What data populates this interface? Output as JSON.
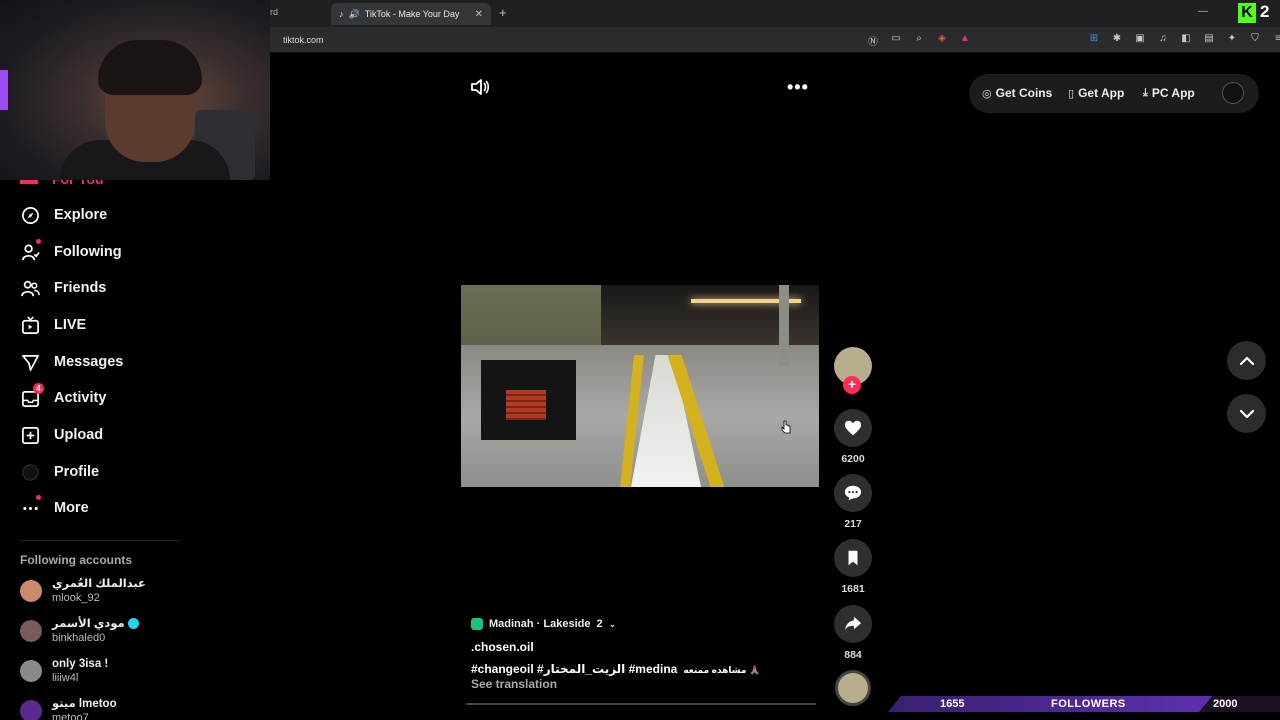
{
  "browser": {
    "partial_tab_label": "rd",
    "active_tab_title": "TikTok - Make Your Day",
    "url": "tiktok.com",
    "kick_count": "2"
  },
  "sidebar": {
    "for_you_label": "For You",
    "items": [
      {
        "label": "Explore",
        "icon": "compass-icon"
      },
      {
        "label": "Following",
        "icon": "user-follow-icon"
      },
      {
        "label": "Friends",
        "icon": "friends-icon"
      },
      {
        "label": "LIVE",
        "icon": "live-tv-icon"
      },
      {
        "label": "Messages",
        "icon": "paper-plane-icon"
      },
      {
        "label": "Activity",
        "icon": "inbox-icon",
        "badge": "4"
      },
      {
        "label": "Upload",
        "icon": "plus-square-icon"
      },
      {
        "label": "Profile",
        "icon": "profile-icon"
      },
      {
        "label": "More",
        "icon": "ellipsis-icon"
      }
    ],
    "following_title": "Following accounts",
    "accounts": [
      {
        "display": "عبدالملك العُمري",
        "username": "mlook_92",
        "verified": false
      },
      {
        "display": "مودي الأسمر",
        "username": "binkhaled0",
        "verified": true
      },
      {
        "display": "only 3isa !",
        "username": "liiiw4l",
        "verified": false
      },
      {
        "display": "ميتو lmetoo",
        "username": "metoo7",
        "verified": false
      }
    ]
  },
  "video": {
    "location": "Madinah · Lakeside",
    "location_count": "2",
    "author": ".chosen.oil",
    "hashtags": "#changeoil  #الزيت_المختار  #medina",
    "caption_extra": "مشاهده ممتعه 🙏🏽",
    "see_translation": "See translation"
  },
  "actions": {
    "likes": "6200",
    "comments": "217",
    "saves": "1681",
    "shares": "884"
  },
  "header": {
    "get_coins": "Get Coins",
    "get_app": "Get App",
    "pc_app": "PC App"
  },
  "followers_goal": {
    "current": "1655",
    "label": "FOLLOWERS",
    "goal": "2000",
    "progress_fraction": 0.8275
  },
  "colors": {
    "accent": "#fe2c55",
    "goal_bar": "#5e2fb0",
    "kick_green": "#53fc18"
  }
}
